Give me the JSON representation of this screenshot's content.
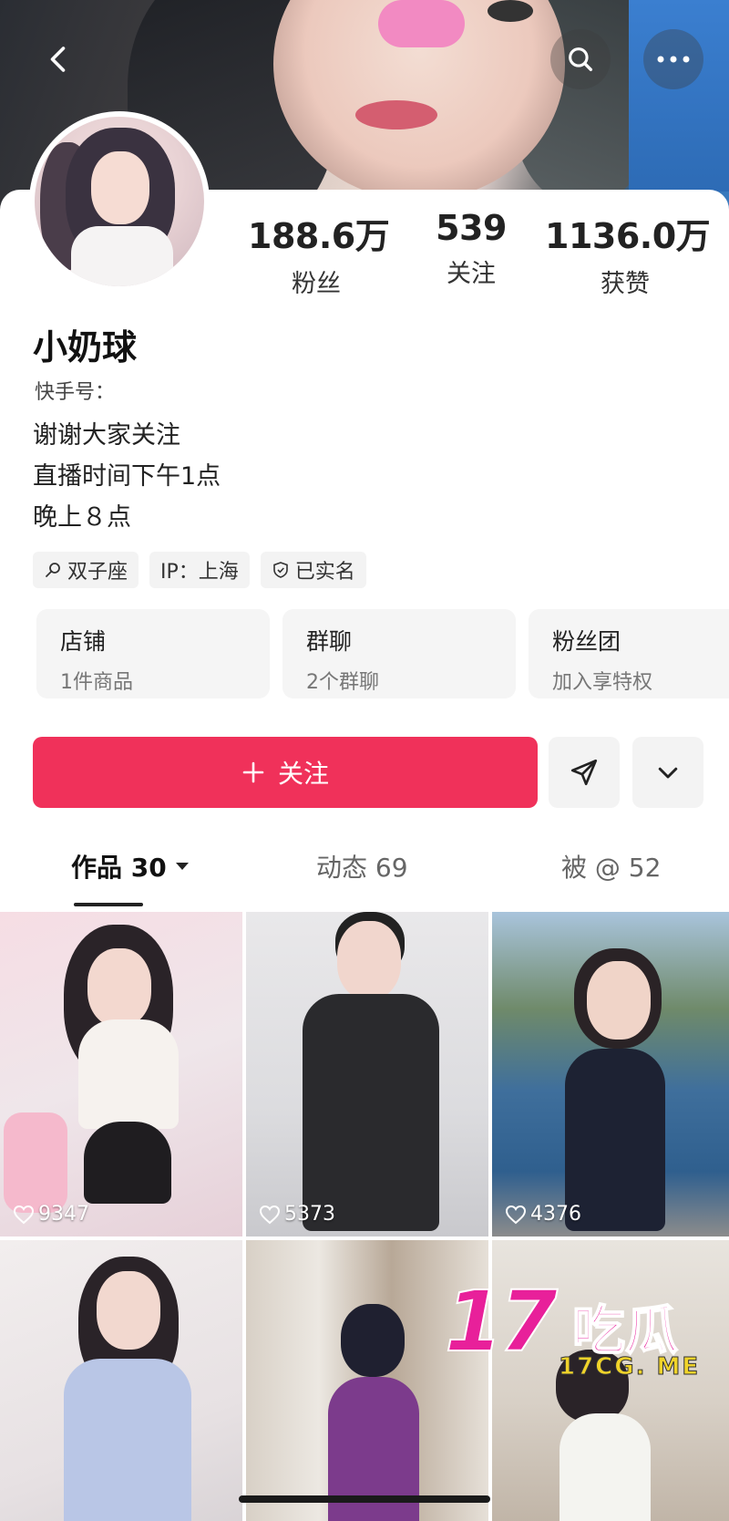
{
  "header": {
    "back_icon": "chevron-left-icon",
    "search_icon": "search-icon",
    "more_icon": "more-horizontal-icon"
  },
  "profile": {
    "name": "小奶球",
    "kuaishou_id_label": "快手号：",
    "bio_lines": [
      "谢谢大家关注",
      "直播时间下午1点",
      "晚上８点"
    ],
    "stats": [
      {
        "value": "188.6万",
        "label": "粉丝"
      },
      {
        "value": "539",
        "label": "关注"
      },
      {
        "value": "1136.0万",
        "label": "获赞"
      }
    ],
    "tags": [
      {
        "icon": "zodiac-icon",
        "text": "双子座"
      },
      {
        "icon": "",
        "text": "IP：上海"
      },
      {
        "icon": "verified-shield-icon",
        "text": "已实名"
      }
    ]
  },
  "cards": [
    {
      "title": "店铺",
      "subtitle": "1件商品"
    },
    {
      "title": "群聊",
      "subtitle": "2个群聊"
    },
    {
      "title": "粉丝团",
      "subtitle": "加入享特权"
    }
  ],
  "actions": {
    "follow_label": "关注",
    "follow_icon": "plus-icon",
    "message_icon": "send-icon",
    "expand_icon": "chevron-down-icon"
  },
  "tabs": [
    {
      "label": "作品 30",
      "active": true
    },
    {
      "label": "动态 69",
      "active": false
    },
    {
      "label": "被 @ 52",
      "active": false
    }
  ],
  "videos": [
    {
      "likes": "9347"
    },
    {
      "likes": "5373"
    },
    {
      "likes": "4376"
    },
    {
      "likes": ""
    },
    {
      "likes": ""
    },
    {
      "likes": ""
    }
  ],
  "watermark": {
    "main": "17",
    "han": "吃瓜",
    "sub": "17CG. ME"
  },
  "colors": {
    "accent": "#f0315a",
    "watermark": "#e8209a"
  }
}
